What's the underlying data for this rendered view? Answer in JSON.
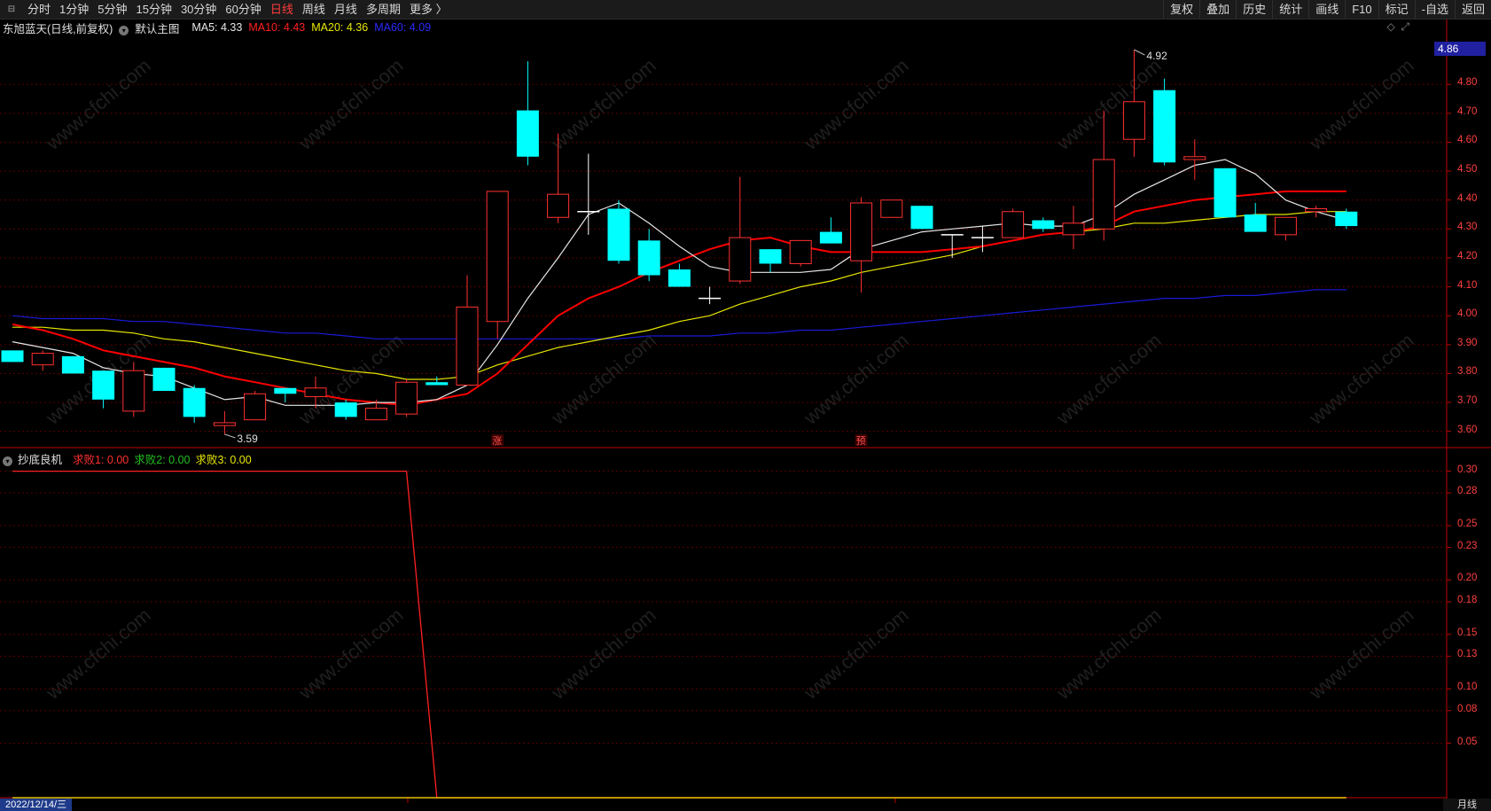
{
  "toolbar": {
    "periods": [
      "分时",
      "1分钟",
      "5分钟",
      "15分钟",
      "30分钟",
      "60分钟",
      "日线",
      "周线",
      "月线",
      "多周期",
      "更多 〉"
    ],
    "active_period": "日线",
    "actions": [
      "复权",
      "叠加",
      "历史",
      "统计",
      "画线",
      "F10",
      "标记",
      "-自选",
      "返回"
    ]
  },
  "main_chart": {
    "stock_name": "东旭蓝天(日线,前复权)",
    "template": "默认主图",
    "ma5": "MA5: 4.33",
    "ma10": "MA10: 4.43",
    "ma20": "MA20: 4.36",
    "ma60": "MA60: 4.09",
    "current_price_tag": "4.86",
    "high_label": "4.92",
    "low_label": "3.59",
    "marker_zhang": "涨",
    "marker_yu": "预",
    "y_ticks": [
      "4.80",
      "4.70",
      "4.60",
      "4.50",
      "4.40",
      "4.30",
      "4.20",
      "4.10",
      "4.00",
      "3.90",
      "3.80",
      "3.70",
      "3.60"
    ],
    "icons": [
      "diamond-icon",
      "expand-icon"
    ]
  },
  "sub_chart": {
    "name": "抄底良机",
    "s1": "求败1: 0.00",
    "s2": "求败2: 0.00",
    "s3": "求败3: 0.00",
    "y_ticks": [
      "0.30",
      "0.28",
      "0.25",
      "0.23",
      "0.20",
      "0.18",
      "0.15",
      "0.13",
      "0.10",
      "0.08",
      "0.05"
    ]
  },
  "footer": {
    "date": "2022/12/14/三",
    "period": "月线"
  },
  "watermark": "www.cfchi.com",
  "colors": {
    "up": "#ff3030",
    "down": "#00ffff",
    "ma5": "#e6e6e6",
    "ma10": "#ff0000",
    "ma20": "#e6e600",
    "ma60": "#1a1ad6",
    "axis": "#c00000"
  },
  "chart_data": {
    "type": "candlestick",
    "ylim": [
      3.55,
      4.96
    ],
    "candles": [
      {
        "o": 3.88,
        "h": 3.88,
        "l": 3.84,
        "c": 3.84
      },
      {
        "o": 3.83,
        "h": 3.88,
        "l": 3.81,
        "c": 3.87
      },
      {
        "o": 3.86,
        "h": 3.86,
        "l": 3.8,
        "c": 3.8
      },
      {
        "o": 3.81,
        "h": 3.81,
        "l": 3.68,
        "c": 3.71
      },
      {
        "o": 3.67,
        "h": 3.84,
        "l": 3.65,
        "c": 3.81
      },
      {
        "o": 3.82,
        "h": 3.82,
        "l": 3.74,
        "c": 3.74
      },
      {
        "o": 3.75,
        "h": 3.76,
        "l": 3.63,
        "c": 3.65
      },
      {
        "o": 3.62,
        "h": 3.67,
        "l": 3.59,
        "c": 3.63
      },
      {
        "o": 3.64,
        "h": 3.74,
        "l": 3.64,
        "c": 3.73
      },
      {
        "o": 3.75,
        "h": 3.75,
        "l": 3.7,
        "c": 3.73
      },
      {
        "o": 3.72,
        "h": 3.79,
        "l": 3.68,
        "c": 3.75
      },
      {
        "o": 3.7,
        "h": 3.71,
        "l": 3.64,
        "c": 3.65
      },
      {
        "o": 3.64,
        "h": 3.71,
        "l": 3.64,
        "c": 3.68
      },
      {
        "o": 3.66,
        "h": 3.78,
        "l": 3.65,
        "c": 3.77
      },
      {
        "o": 3.77,
        "h": 3.79,
        "l": 3.76,
        "c": 3.76
      },
      {
        "o": 3.76,
        "h": 4.14,
        "l": 3.76,
        "c": 4.03
      },
      {
        "o": 3.98,
        "h": 4.43,
        "l": 3.92,
        "c": 4.43
      },
      {
        "o": 4.71,
        "h": 4.88,
        "l": 4.52,
        "c": 4.55
      },
      {
        "o": 4.34,
        "h": 4.63,
        "l": 4.32,
        "c": 4.42
      },
      {
        "o": 4.36,
        "h": 4.56,
        "l": 4.28,
        "c": 4.36
      },
      {
        "o": 4.37,
        "h": 4.4,
        "l": 4.18,
        "c": 4.19
      },
      {
        "o": 4.26,
        "h": 4.3,
        "l": 4.12,
        "c": 4.14
      },
      {
        "o": 4.16,
        "h": 4.18,
        "l": 4.1,
        "c": 4.1
      },
      {
        "o": 4.06,
        "h": 4.1,
        "l": 4.04,
        "c": 4.06
      },
      {
        "o": 4.12,
        "h": 4.48,
        "l": 4.11,
        "c": 4.27
      },
      {
        "o": 4.23,
        "h": 4.23,
        "l": 4.15,
        "c": 4.18
      },
      {
        "o": 4.18,
        "h": 4.26,
        "l": 4.17,
        "c": 4.26
      },
      {
        "o": 4.29,
        "h": 4.34,
        "l": 4.25,
        "c": 4.25
      },
      {
        "o": 4.19,
        "h": 4.41,
        "l": 4.08,
        "c": 4.39
      },
      {
        "o": 4.34,
        "h": 4.4,
        "l": 4.34,
        "c": 4.4
      },
      {
        "o": 4.38,
        "h": 4.38,
        "l": 4.3,
        "c": 4.3
      },
      {
        "o": 4.28,
        "h": 4.28,
        "l": 4.2,
        "c": 4.28
      },
      {
        "o": 4.27,
        "h": 4.31,
        "l": 4.22,
        "c": 4.27
      },
      {
        "o": 4.27,
        "h": 4.37,
        "l": 4.27,
        "c": 4.36
      },
      {
        "o": 4.33,
        "h": 4.34,
        "l": 4.29,
        "c": 4.3
      },
      {
        "o": 4.28,
        "h": 4.38,
        "l": 4.23,
        "c": 4.32
      },
      {
        "o": 4.3,
        "h": 4.71,
        "l": 4.26,
        "c": 4.54
      },
      {
        "o": 4.61,
        "h": 4.92,
        "l": 4.55,
        "c": 4.74
      },
      {
        "o": 4.78,
        "h": 4.82,
        "l": 4.52,
        "c": 4.53
      },
      {
        "o": 4.54,
        "h": 4.61,
        "l": 4.47,
        "c": 4.55
      },
      {
        "o": 4.51,
        "h": 4.51,
        "l": 4.34,
        "c": 4.34
      },
      {
        "o": 4.35,
        "h": 4.39,
        "l": 4.3,
        "c": 4.29
      },
      {
        "o": 4.28,
        "h": 4.34,
        "l": 4.26,
        "c": 4.34
      },
      {
        "o": 4.36,
        "h": 4.38,
        "l": 4.34,
        "c": 4.37
      },
      {
        "o": 4.36,
        "h": 4.37,
        "l": 4.3,
        "c": 4.31
      }
    ],
    "ma5": [
      3.91,
      3.89,
      3.87,
      3.82,
      3.8,
      3.79,
      3.75,
      3.71,
      3.72,
      3.69,
      3.69,
      3.69,
      3.7,
      3.7,
      3.71,
      3.76,
      3.9,
      4.06,
      4.2,
      4.35,
      4.39,
      4.32,
      4.24,
      4.17,
      4.15,
      4.15,
      4.15,
      4.16,
      4.23,
      4.26,
      4.29,
      4.3,
      4.31,
      4.32,
      4.31,
      4.31,
      4.35,
      4.42,
      4.47,
      4.52,
      4.54,
      4.49,
      4.4,
      4.36,
      4.33
    ],
    "ma10": [
      3.97,
      3.95,
      3.92,
      3.88,
      3.86,
      3.84,
      3.82,
      3.79,
      3.77,
      3.75,
      3.73,
      3.71,
      3.7,
      3.69,
      3.71,
      3.73,
      3.8,
      3.9,
      4.0,
      4.06,
      4.1,
      4.15,
      4.19,
      4.23,
      4.26,
      4.27,
      4.24,
      4.22,
      4.22,
      4.22,
      4.22,
      4.23,
      4.24,
      4.26,
      4.28,
      4.29,
      4.31,
      4.36,
      4.38,
      4.4,
      4.41,
      4.42,
      4.43,
      4.43,
      4.43
    ],
    "ma20": [
      3.96,
      3.96,
      3.95,
      3.95,
      3.94,
      3.92,
      3.91,
      3.89,
      3.87,
      3.85,
      3.83,
      3.81,
      3.8,
      3.78,
      3.78,
      3.79,
      3.83,
      3.86,
      3.89,
      3.91,
      3.93,
      3.95,
      3.98,
      4.0,
      4.04,
      4.07,
      4.1,
      4.12,
      4.15,
      4.17,
      4.19,
      4.21,
      4.24,
      4.26,
      4.28,
      4.29,
      4.3,
      4.32,
      4.32,
      4.33,
      4.34,
      4.35,
      4.35,
      4.36,
      4.36
    ],
    "ma60": [
      4.0,
      3.99,
      3.99,
      3.99,
      3.98,
      3.98,
      3.97,
      3.96,
      3.95,
      3.94,
      3.94,
      3.93,
      3.92,
      3.92,
      3.92,
      3.92,
      3.92,
      3.92,
      3.92,
      3.92,
      3.92,
      3.93,
      3.93,
      3.93,
      3.94,
      3.94,
      3.95,
      3.95,
      3.96,
      3.97,
      3.98,
      3.99,
      4.0,
      4.01,
      4.02,
      4.03,
      4.04,
      4.05,
      4.06,
      4.06,
      4.07,
      4.07,
      4.08,
      4.09,
      4.09
    ],
    "sub_series": {
      "name": "求败1",
      "points": [
        [
          0,
          0.3
        ],
        [
          13,
          0.3
        ],
        [
          14,
          0.0
        ],
        [
          44,
          0.0
        ]
      ],
      "baseline": 0.0,
      "ylim": [
        0,
        0.32
      ]
    }
  }
}
